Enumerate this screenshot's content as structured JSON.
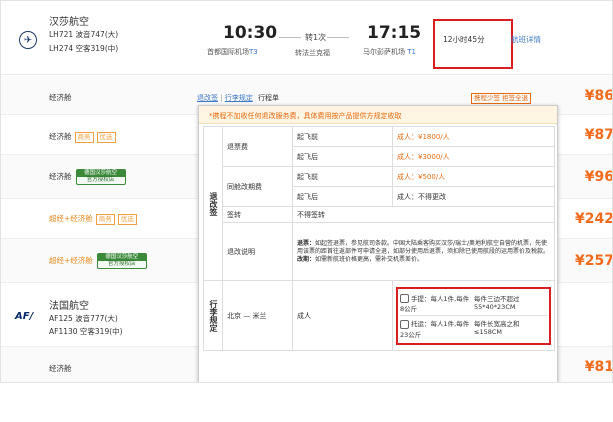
{
  "flight1": {
    "airline": "汉莎航空",
    "seg1": "LH721 波音747(大)",
    "seg2": "LH274 空客319(中)",
    "dep_time": "10:30",
    "dep_airport": "首都国际机场",
    "dep_terminal": "T3",
    "transfer": "转1次",
    "transfer_city": "转法兰克福",
    "arr_time": "17:15",
    "arr_airport": "马尔彭萨机场",
    "arr_terminal": "T1",
    "duration": "12小时45分",
    "details_link": "航班详情"
  },
  "tabs": {
    "refund": "退改签",
    "sep": "|",
    "baggage": "行李规定",
    "itinerary": "行程单"
  },
  "tip_tag": "携程少签 拒签全退",
  "fares": [
    {
      "cls": "经济舱",
      "tags": [],
      "price": "¥86"
    },
    {
      "cls": "经济舱",
      "tags": [
        "商务",
        "优选"
      ],
      "price": "¥87"
    },
    {
      "cls": "经济舱",
      "official": true,
      "price": "¥96"
    },
    {
      "cls": "超经+经济舱",
      "tags": [
        "商务",
        "优选"
      ],
      "price": "¥242"
    },
    {
      "cls": "超经+经济舱",
      "official": true,
      "price": "¥257"
    }
  ],
  "official_badge": {
    "top": "德国汉莎航空",
    "bottom": "官方授权店"
  },
  "flight2": {
    "airline": "法国航空",
    "logo": "AF/",
    "seg1": "AF125 波音777(大)",
    "seg2": "AF1130 空客319(中)",
    "fare_cls": "经济舱",
    "price": "¥81"
  },
  "popup": {
    "warning": "*携程不加收任何退改服务费，具体费用按产品提供方规定收取",
    "section1": "退改签",
    "section2": "行李规定",
    "refund_fee": "退票费",
    "change_fee": "同舱改期费",
    "before": "起飞前",
    "after": "起飞后",
    "r_before": "成人：¥1800/人",
    "r_after": "成人：¥3000/人",
    "c_before": "成人：¥500/人",
    "c_after": "成人：不得更改",
    "endorse": "签转",
    "endorse_val": "不得签转",
    "notes_label": "退改说明",
    "notes_refund_h": "退票：",
    "notes_refund": "如起签退票，参见航司条款。中国大陆乘客购买汉莎/瑞士/奥地利航空自营的机票，先使用该票的距首往返部件可申请全退，如部分使用后退票，须扣除已使用航段的运用票价及税款。",
    "notes_change_h": "改期：",
    "notes_change": "如需新航班价格更高，需补交机票差价。",
    "route": "北京 — 米兰",
    "pax": "成人",
    "carry_label": "手提：每人1件,每件8公斤",
    "carry_size": "每件三边不超过55*40*23CM",
    "check_label": "托运：每人1件,每件23公斤",
    "check_size": "每件长宽高之和≤158CM"
  }
}
